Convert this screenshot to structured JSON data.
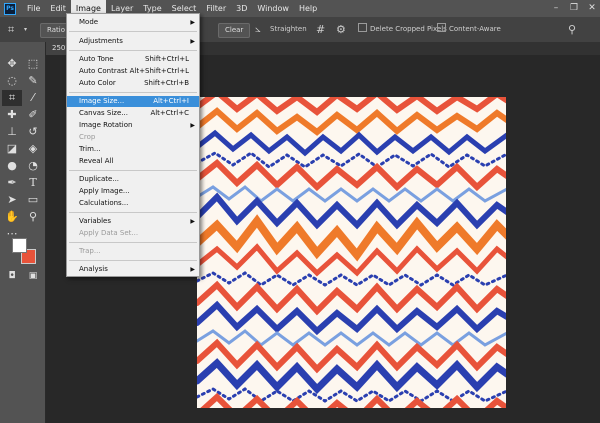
{
  "menubar": {
    "logo": "Ps",
    "items": [
      "File",
      "Edit",
      "Image",
      "Layer",
      "Type",
      "Select",
      "Filter",
      "3D",
      "Window",
      "Help"
    ],
    "active": "Image",
    "window_controls": [
      "–",
      "❐",
      "✕"
    ]
  },
  "options": {
    "ratio_label": "Ratio",
    "clear_label": "Clear",
    "straighten_label": "Straighten",
    "delete_cropped": "Delete Cropped Pixels",
    "content_aware": "Content-Aware"
  },
  "tab": {
    "label": "2507"
  },
  "image_menu": {
    "items": [
      {
        "label": "Mode",
        "submenu": true
      },
      {
        "label": "Adjustments",
        "submenu": true
      },
      {
        "label": "Auto Tone",
        "shortcut": "Shift+Ctrl+L"
      },
      {
        "label": "Auto Contrast",
        "shortcut": "Alt+Shift+Ctrl+L"
      },
      {
        "label": "Auto Color",
        "shortcut": "Shift+Ctrl+B"
      },
      {
        "label": "Image Size...",
        "shortcut": "Alt+Ctrl+I",
        "highlighted": true
      },
      {
        "label": "Canvas Size...",
        "shortcut": "Alt+Ctrl+C"
      },
      {
        "label": "Image Rotation",
        "submenu": true
      },
      {
        "label": "Crop",
        "disabled": true
      },
      {
        "label": "Trim..."
      },
      {
        "label": "Reveal All"
      },
      {
        "label": "Duplicate..."
      },
      {
        "label": "Apply Image..."
      },
      {
        "label": "Calculations..."
      },
      {
        "label": "Variables",
        "submenu": true
      },
      {
        "label": "Apply Data Set...",
        "disabled": true
      },
      {
        "label": "Trap...",
        "disabled": true
      },
      {
        "label": "Analysis",
        "submenu": true
      }
    ]
  },
  "colors": {
    "foreground": "#ffffff",
    "background": "#e8533a",
    "highlight": "#3a8fda"
  },
  "tools": [
    "move-icon",
    "marquee-icon",
    "lasso-icon",
    "quick-select-icon",
    "crop-icon",
    "eyedropper-icon",
    "healing-icon",
    "brush-icon",
    "stamp-icon",
    "history-brush-icon",
    "eraser-icon",
    "bucket-icon",
    "blur-icon",
    "dodge-icon",
    "pen-icon",
    "type-icon",
    "path-select-icon",
    "shape-icon",
    "hand-icon",
    "zoom-icon"
  ]
}
